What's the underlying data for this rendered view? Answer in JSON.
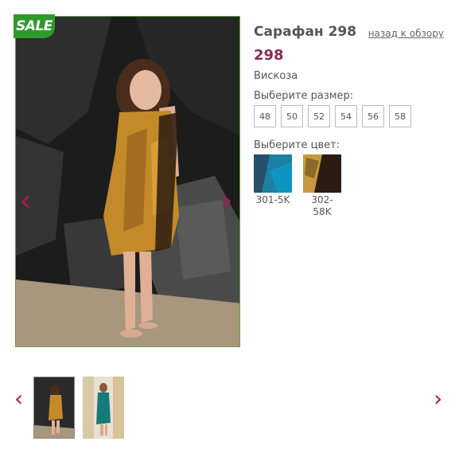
{
  "badge": {
    "sale": "SALE"
  },
  "product": {
    "title": "Сарафан 298",
    "price": "298",
    "material": "Вискоза",
    "back_link": "назад к обзору"
  },
  "sizes": {
    "label": "Выберите размер:",
    "options": [
      "48",
      "50",
      "52",
      "54",
      "56",
      "58"
    ]
  },
  "colors": {
    "label": "Выберите цвет:",
    "options": [
      "301-5K",
      "302-58K"
    ]
  },
  "icons": {
    "prev": "chevron-left-icon",
    "next": "chevron-right-icon"
  },
  "theme": {
    "accent": "#a01e54",
    "price": "#8a2a5a",
    "sale": "#2f9a2c",
    "photo_border": "#5fa044"
  }
}
